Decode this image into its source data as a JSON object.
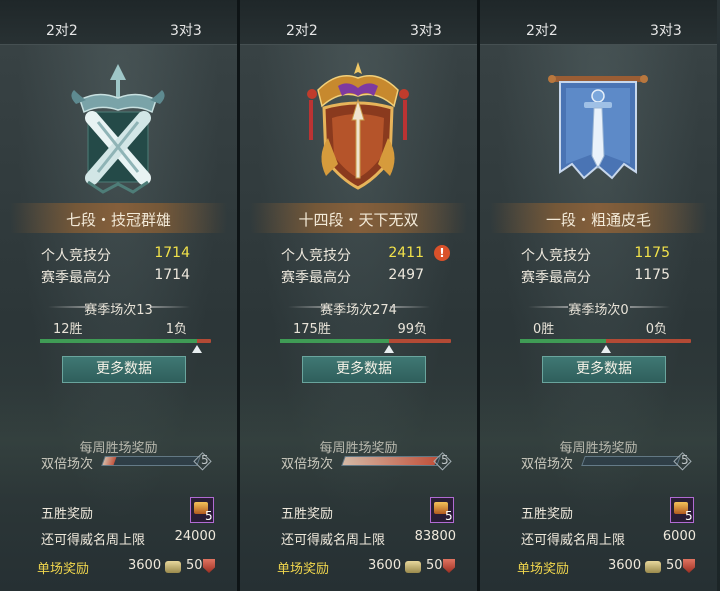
{
  "tabs": {
    "left": "2对2",
    "right": "3对3"
  },
  "labels": {
    "personal_score": "个人竞技分",
    "season_high": "赛季最高分",
    "more_data": "更多数据",
    "weekly_reward": "每周胜场奖励",
    "double": "双倍场次",
    "five_win_reward": "五胜奖励",
    "weekly_cap": "还可得威名周上限",
    "single_reward": "单场奖励"
  },
  "colors": {
    "score_highlight": "#f2e24a",
    "win": "#3f9b55",
    "loss": "#b34a35",
    "single_reward": "#f0d64d"
  },
  "panels": [
    {
      "rank_title": "七段・技冠群雄",
      "emblem": "crossed-swords-emblem",
      "personal_score": "1714",
      "season_high": "1714",
      "season_games": "赛季场次13",
      "wins": "12胜",
      "losses": "1负",
      "win_ratio": 0.92,
      "warning": false,
      "double_remaining": "5",
      "double_progress": 0.12,
      "five_win_count": "5",
      "weekly_cap": "24000",
      "single_coin": "3600",
      "single_honor": "50"
    },
    {
      "rank_title": "十四段・天下无双",
      "emblem": "golden-sword-crest-emblem",
      "personal_score": "2411",
      "season_high": "2497",
      "season_games": "赛季场次274",
      "wins": "175胜",
      "losses": "99负",
      "win_ratio": 0.64,
      "warning": true,
      "warning_glyph": "!",
      "double_remaining": "5",
      "double_progress": 0.98,
      "five_win_count": "5",
      "weekly_cap": "83800",
      "single_coin": "3600",
      "single_honor": "50"
    },
    {
      "rank_title": "一段・粗通皮毛",
      "emblem": "blue-banner-sword-emblem",
      "personal_score": "1175",
      "season_high": "1175",
      "season_games": "赛季场次0",
      "wins": "0胜",
      "losses": "0负",
      "win_ratio": 0.5,
      "warning": false,
      "double_remaining": "5",
      "double_progress": 0.0,
      "five_win_count": "5",
      "weekly_cap": "6000",
      "single_coin": "3600",
      "single_honor": "50"
    }
  ]
}
